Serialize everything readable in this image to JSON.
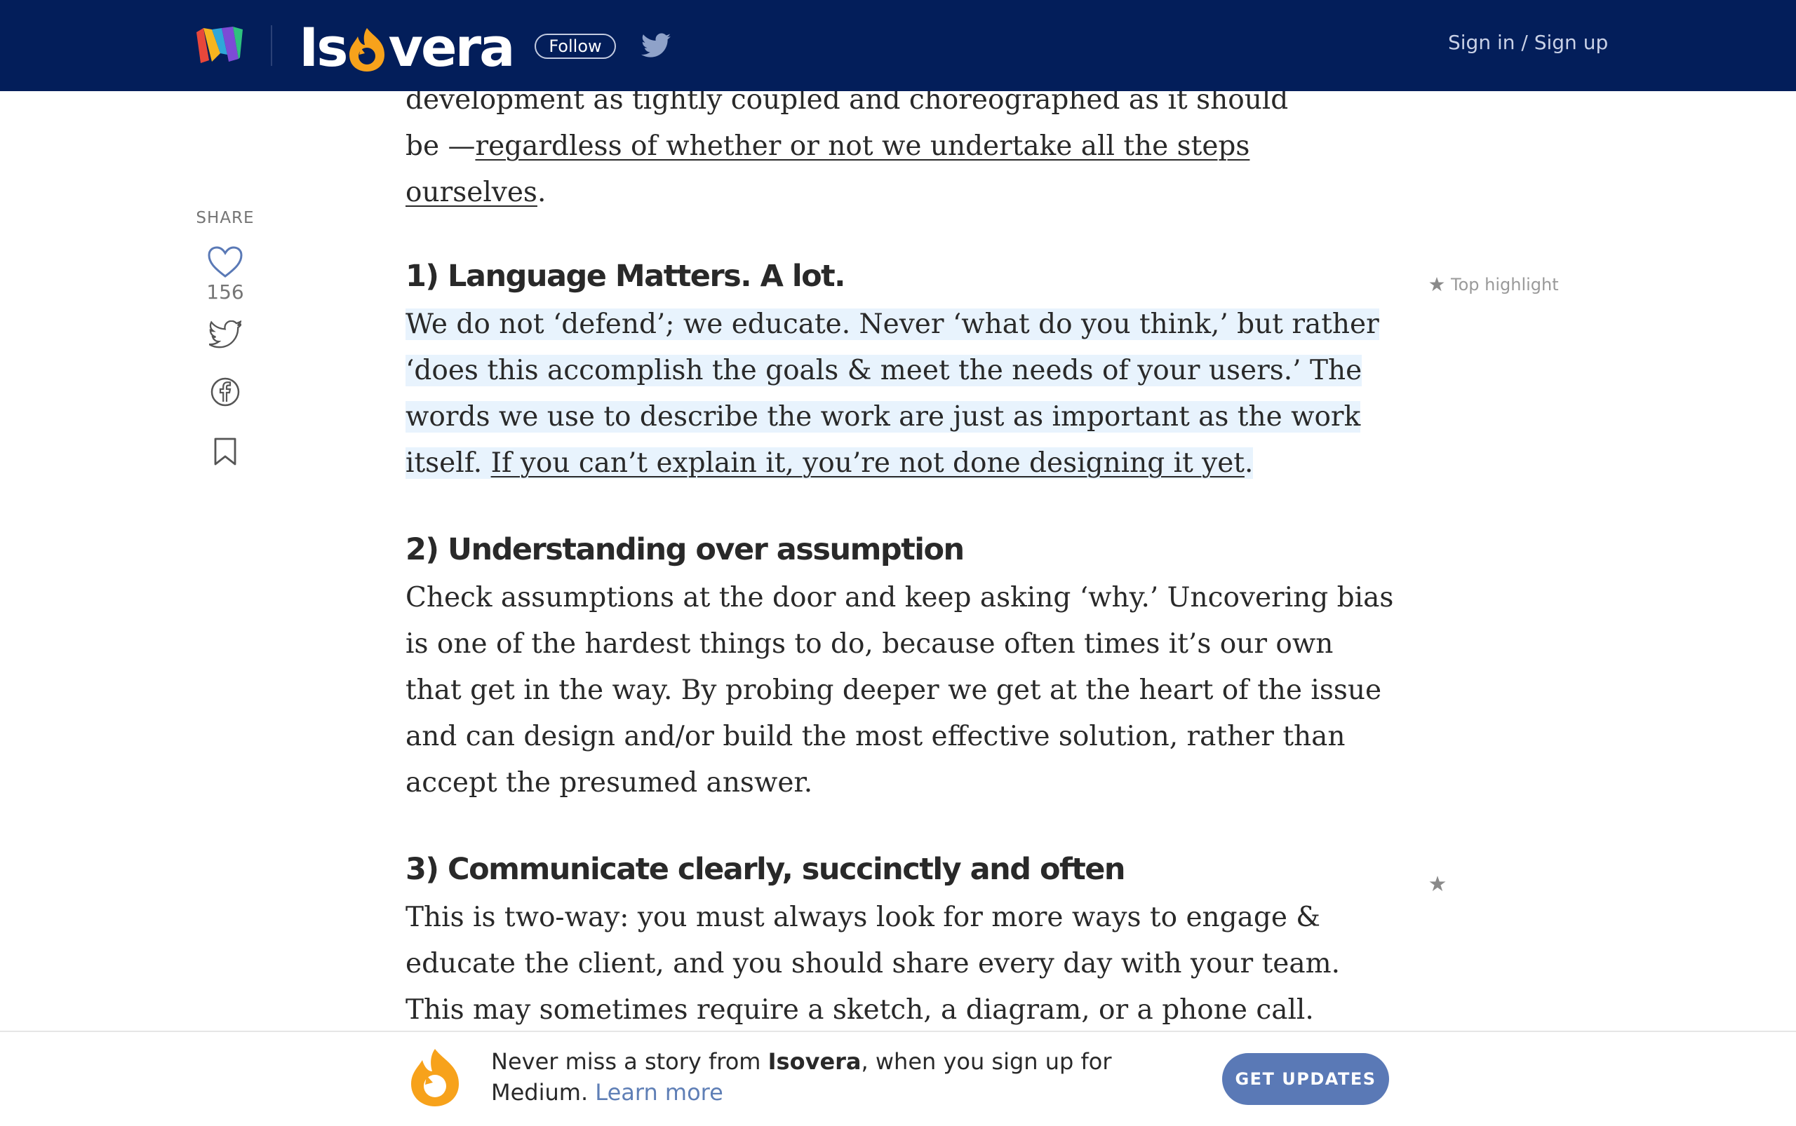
{
  "header": {
    "brand_name": "Isovera",
    "follow_label": "Follow",
    "signin_label": "Sign in / Sign up"
  },
  "share": {
    "label": "SHARE",
    "clap_count": "156"
  },
  "article": {
    "intro": {
      "before": "development as tightly coupled and choreographed as it should be —",
      "link": "regardless of whether or not we undertake all the steps ourselves",
      "after": "."
    },
    "sections": [
      {
        "heading": "1) Language Matters. A lot.",
        "text_plain": "We do not ‘defend’; we educate. Never ‘what do you think,’ but rather ‘does this accomplish the goals & meet the needs of your users.’ The words we use to describe the work are just as important as the work itself. ",
        "text_link": "If you can’t explain it, you’re not done designing it yet",
        "text_end": "."
      },
      {
        "heading": "2) Understanding over assumption",
        "text": "Check assumptions at the door and keep asking ‘why.’ Uncovering bias is one of the hardest things to do, because often times it’s our own that get in the way. By probing deeper we get at the heart of the issue and can design and/or build the most effective solution, rather than accept the presumed answer."
      },
      {
        "heading": "3) Communicate clearly, succinctly and often",
        "text": "This is two-way: you must always look for more ways to engage & educate the client, and you should share every day with your team. This may sometimes require a sketch, a diagram, or a phone call. Don’t forget that sometimes a quick check-in will avoid hours of wasted efforts."
      }
    ],
    "top_highlight_label": "Top highlight"
  },
  "banner": {
    "text_before": "Never miss a story from ",
    "brand": "Isovera",
    "text_after": ", when you sign up for Medium. ",
    "learn_more": "Learn more",
    "cta": "GET UPDATES"
  },
  "colors": {
    "topbar": "#031e5a",
    "highlight": "#e8f3fd",
    "accent_orange": "#f7a21b",
    "button_blue": "#5a79b6"
  }
}
